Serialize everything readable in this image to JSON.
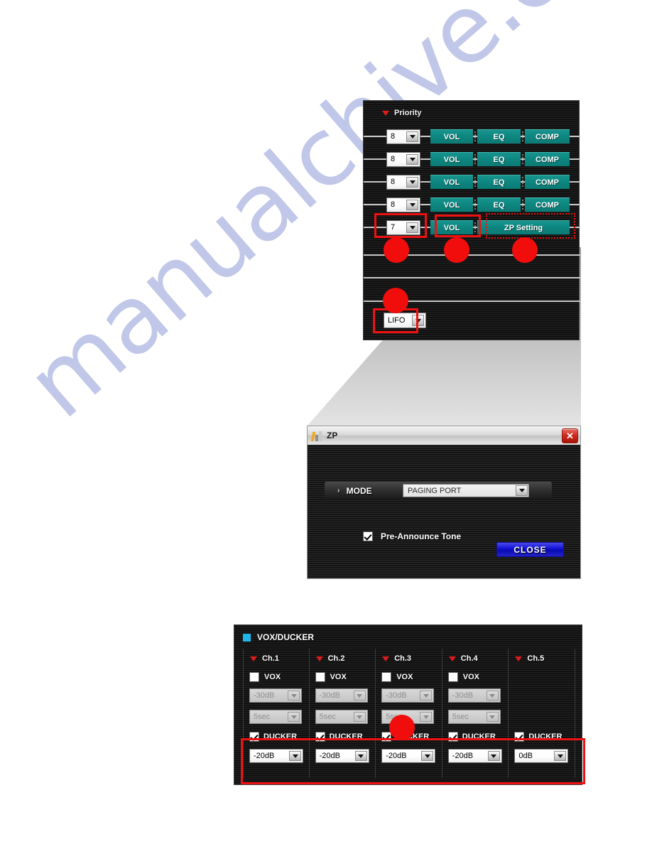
{
  "watermark": {
    "text": "manualchive.com",
    "color": "#8e9ad6"
  },
  "colors": {
    "teal_button": "#0e8781",
    "highlight_red": "#ee1111",
    "callout_dot": "#f20d0d",
    "accent_cyan": "#1fb7e8",
    "marker_red": "#e01b1b",
    "close_blue": "#1414d8"
  },
  "priority_panel": {
    "header": {
      "label": "Priority",
      "marker_icon": "triangle-down-icon"
    },
    "rows": [
      {
        "priority": "8",
        "buttons": [
          "VOL",
          "EQ",
          "COMP"
        ]
      },
      {
        "priority": "8",
        "buttons": [
          "VOL",
          "EQ",
          "COMP"
        ]
      },
      {
        "priority": "8",
        "buttons": [
          "VOL",
          "EQ",
          "COMP"
        ]
      },
      {
        "priority": "8",
        "buttons": [
          "VOL",
          "EQ",
          "COMP"
        ]
      },
      {
        "priority": "7",
        "buttons": [
          "VOL",
          "ZP Setting"
        ]
      }
    ],
    "mode_select": {
      "value": "LIFO"
    }
  },
  "zp_dialog": {
    "title": "ZP",
    "title_icon": "app-bars-icon",
    "close_icon": "close-icon",
    "mode": {
      "label": "MODE",
      "chevron_icon": "chevron-right-icon",
      "value": "PAGING PORT"
    },
    "pre_announce": {
      "label": "Pre-Announce Tone",
      "checked": true
    },
    "close_button": {
      "label": "CLOSE"
    }
  },
  "vox_panel": {
    "header": {
      "label": "VOX/DUCKER",
      "icon": "square-cyan-icon"
    },
    "channels": [
      {
        "name": "Ch.1",
        "vox": {
          "label": "VOX",
          "checked": false,
          "enabled": false
        },
        "threshold": {
          "value": "-30dB",
          "enabled": false
        },
        "hold_time": {
          "value": "5sec",
          "enabled": false
        },
        "ducker": {
          "label": "DUCKER",
          "checked": true
        },
        "ducker_level": {
          "value": "-20dB",
          "enabled": true
        }
      },
      {
        "name": "Ch.2",
        "vox": {
          "label": "VOX",
          "checked": false,
          "enabled": false
        },
        "threshold": {
          "value": "-30dB",
          "enabled": false
        },
        "hold_time": {
          "value": "5sec",
          "enabled": false
        },
        "ducker": {
          "label": "DUCKER",
          "checked": true
        },
        "ducker_level": {
          "value": "-20dB",
          "enabled": true
        }
      },
      {
        "name": "Ch.3",
        "vox": {
          "label": "VOX",
          "checked": false,
          "enabled": false
        },
        "threshold": {
          "value": "-30dB",
          "enabled": false
        },
        "hold_time": {
          "value": "5sec",
          "enabled": false
        },
        "ducker": {
          "label": "DUCKER",
          "checked": true
        },
        "ducker_level": {
          "value": "-20dB",
          "enabled": true
        }
      },
      {
        "name": "Ch.4",
        "vox": {
          "label": "VOX",
          "checked": false,
          "enabled": false
        },
        "threshold": {
          "value": "-30dB",
          "enabled": false
        },
        "hold_time": {
          "value": "5sec",
          "enabled": false
        },
        "ducker": {
          "label": "DUCKER",
          "checked": true
        },
        "ducker_level": {
          "value": "-20dB",
          "enabled": true
        }
      },
      {
        "name": "Ch.5",
        "vox": null,
        "threshold": null,
        "hold_time": null,
        "ducker": {
          "label": "DUCKER",
          "checked": true
        },
        "ducker_level": {
          "value": "0dB",
          "enabled": true
        }
      }
    ]
  }
}
